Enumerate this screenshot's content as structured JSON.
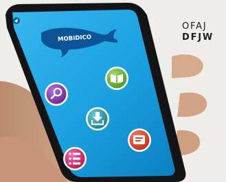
{
  "app": {
    "name": "MOBIDICO"
  },
  "logo": {
    "line_1": "OFAJ",
    "line_2": "DFJW"
  },
  "icons": [
    "search-icon",
    "book-icon",
    "download-icon",
    "list-icon",
    "message-icon"
  ],
  "colors": {
    "screen_blue": "#1aa0e0",
    "search_button": "#7c3ba0",
    "book_button": "#6db33f",
    "download_button": "#2a9bb0",
    "list_button": "#d8307a",
    "message_button": "#e2452e"
  }
}
